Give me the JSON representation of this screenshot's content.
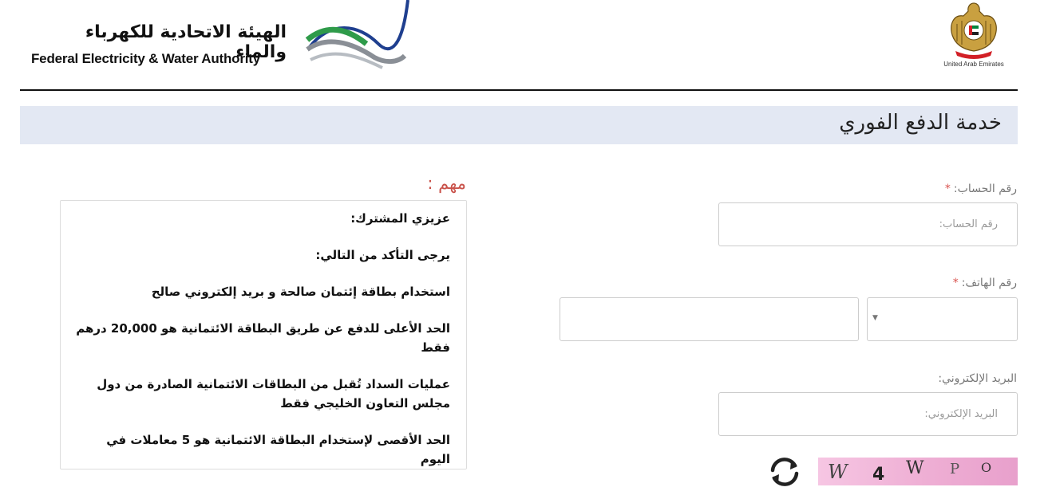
{
  "header": {
    "org_name_ar": "الهيئة الاتحادية للكهرباء والماء",
    "org_name_en": "Federal Electricity & Water Authority",
    "emblem_label": "United Arab Emirates"
  },
  "page": {
    "title": "خدمة الدفع الفوري"
  },
  "form": {
    "account": {
      "label": "رقم الحساب:",
      "required_mark": "*",
      "placeholder": "رقم الحساب:"
    },
    "phone": {
      "label": "رقم الهاتف:",
      "required_mark": "*",
      "country_code_value": "",
      "number_value": ""
    },
    "email": {
      "label": "البريد الإلكتروني:",
      "placeholder": "البريد الإلكتروني:"
    },
    "captcha": {
      "chars": [
        "W",
        "4",
        "W",
        "P",
        "O"
      ]
    }
  },
  "notice": {
    "title": "مهم :",
    "greeting": "عزيزي المشترك:",
    "ensure": "يرجى التأكد من التالي:",
    "items": [
      "استخدام بطاقة إئتمان صالحة و بريد إلكتروني صالح",
      "الحد الأعلى للدفع عن طريق البطاقة الائتمانية هو 20,000 درهم فقط",
      "عمليات السداد تُقبل من البطاقات الائتمانية الصادرة من دول مجلس التعاون الخليجي فقط",
      "الحد الأقصى لإستخدام البطاقة الائتمانية هو 5 معاملات في اليوم"
    ]
  },
  "colors": {
    "title_bar_bg": "#e3e8f3",
    "required": "#d9534f",
    "notice_title": "#c9524a",
    "captcha_bg": "#efb0d5"
  },
  "icons": {
    "refresh": "refresh-icon",
    "dropdown": "chevron-down-icon"
  }
}
